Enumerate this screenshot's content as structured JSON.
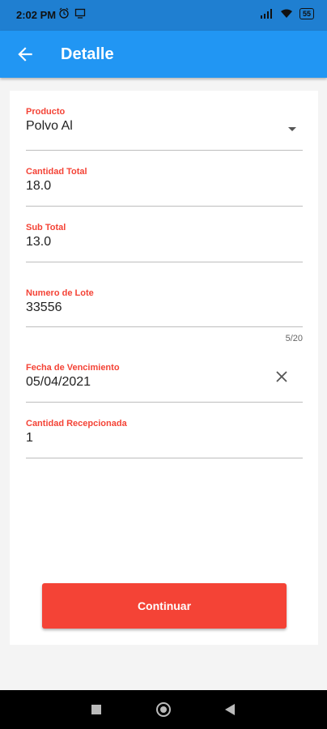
{
  "status_bar": {
    "time": "2:02 PM",
    "battery": "55"
  },
  "app_bar": {
    "title": "Detalle"
  },
  "form": {
    "producto": {
      "label": "Producto",
      "value": "Polvo Al"
    },
    "cantidad_total": {
      "label": "Cantidad Total",
      "value": "18.0"
    },
    "sub_total": {
      "label": "Sub Total",
      "value": "13.0"
    },
    "numero_lote": {
      "label": "Numero de Lote",
      "value": "33556",
      "counter": "5/20"
    },
    "fecha_vencimiento": {
      "label": "Fecha de Vencimiento",
      "value": "05/04/2021"
    },
    "cantidad_recepcionada": {
      "label": "Cantidad Recepcionada",
      "value": "1"
    }
  },
  "actions": {
    "continue_label": "Continuar"
  },
  "colors": {
    "primary": "#2196f3",
    "accent": "#f44336",
    "status_bar": "#1f7fd1"
  },
  "icons": [
    "back-arrow-icon",
    "dropdown-arrow-icon",
    "clear-icon",
    "alarm-icon",
    "cast-icon",
    "signal-icon",
    "wifi-icon",
    "battery-icon"
  ]
}
